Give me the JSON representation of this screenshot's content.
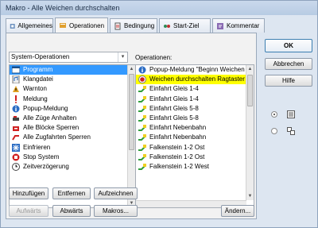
{
  "window": {
    "title": "Makro - Alle Weichen durchschalten"
  },
  "tabs": [
    {
      "label": "Allgemeines",
      "icon": "settings-tab-icon"
    },
    {
      "label": "Operationen",
      "icon": "operations-tab-icon"
    },
    {
      "label": "Bedingung",
      "icon": "condition-tab-icon"
    },
    {
      "label": "Start-Ziel",
      "icon": "start-target-tab-icon"
    },
    {
      "label": "Kommentar",
      "icon": "comment-tab-icon"
    }
  ],
  "category_select": {
    "value": "System-Operationen"
  },
  "operations_label": "Operationen:",
  "system_operations": [
    {
      "label": "Programm",
      "icon": "program-icon",
      "selected": true
    },
    {
      "label": "Klangdatei",
      "icon": "sound-file-icon"
    },
    {
      "label": "Warnton",
      "icon": "warning-tone-icon"
    },
    {
      "label": "Meldung",
      "icon": "message-icon"
    },
    {
      "label": "Popup-Meldung",
      "icon": "popup-message-icon"
    },
    {
      "label": "Alle Züge Anhalten",
      "icon": "stop-trains-icon"
    },
    {
      "label": "Alle Blöcke Sperren",
      "icon": "lock-blocks-icon"
    },
    {
      "label": "Alle Zugfahrten Sperren",
      "icon": "lock-routes-icon"
    },
    {
      "label": "Einfrieren",
      "icon": "freeze-icon"
    },
    {
      "label": "Stop System",
      "icon": "stop-system-icon"
    },
    {
      "label": "Zeitverzögerung",
      "icon": "delay-icon"
    }
  ],
  "operations": [
    {
      "label": "Popup-Meldung \"Beginn Weichen du",
      "icon": "popup-message-icon"
    },
    {
      "label": "Weichen durchschalten Ragtaster",
      "icon": "record-icon",
      "highlighted": true
    },
    {
      "label": "Einfahrt Gleis 1-4",
      "icon": "route-icon"
    },
    {
      "label": "Einfahrt Gleis 1-4",
      "icon": "route-icon"
    },
    {
      "label": "Einfahrt Gleis 5-8",
      "icon": "route-icon"
    },
    {
      "label": "Einfahrt Gleis 5-8",
      "icon": "route-icon"
    },
    {
      "label": "Einfahrt Nebenbahn",
      "icon": "route-icon"
    },
    {
      "label": "Einfahrt Nebenbahn",
      "icon": "route-icon"
    },
    {
      "label": "Falkenstein 1-2 Ost",
      "icon": "route-icon"
    },
    {
      "label": "Falkenstein 1-2 Ost",
      "icon": "route-icon"
    },
    {
      "label": "Falkenstein 1-2 West",
      "icon": "route-icon"
    }
  ],
  "buttons": {
    "add": "Hinzufügen",
    "remove": "Entfernen",
    "record": "Aufzeichnen",
    "up": "Aufwärts",
    "down": "Abwärts",
    "macros": "Makros...",
    "change": "Ändern...",
    "ok": "OK",
    "cancel": "Abbrechen",
    "help": "Hilfe"
  },
  "view_options": [
    {
      "icon": "list-view-icon",
      "selected": true
    },
    {
      "icon": "tile-view-icon",
      "selected": false
    }
  ],
  "colors": {
    "selection": "#3399ff",
    "highlight": "#ffff00",
    "chrome": "#dde6f1"
  }
}
